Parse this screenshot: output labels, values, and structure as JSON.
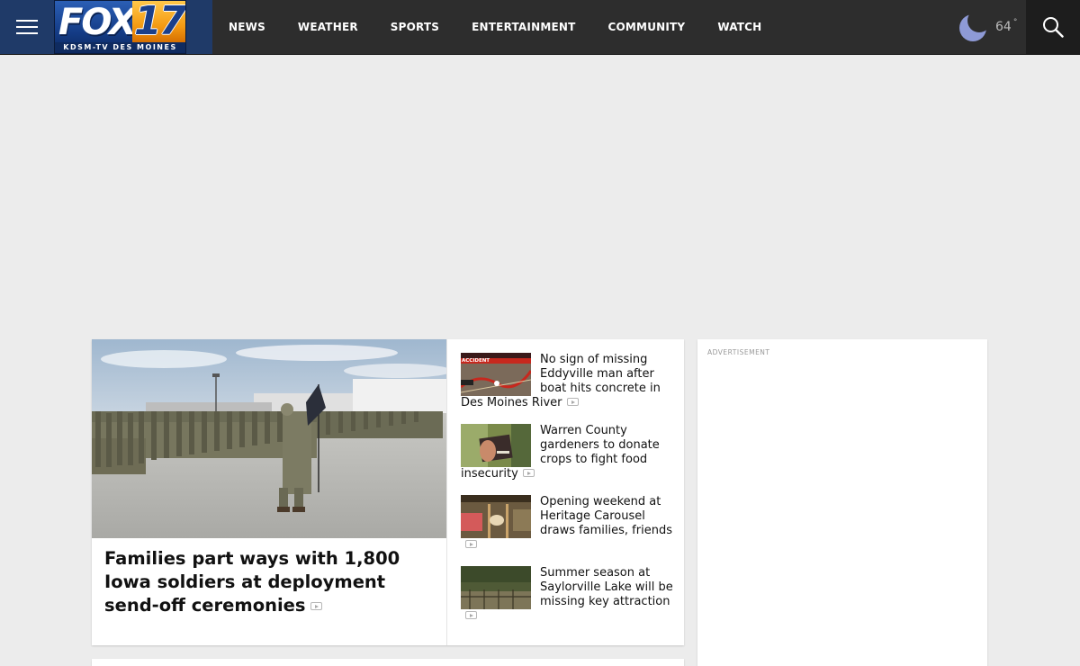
{
  "header": {
    "menu_icon": "hamburger-menu-icon",
    "logo": {
      "text_main": "FOX",
      "text_number": "17",
      "tagline": "KDSM-TV DES MOINES",
      "colors": {
        "blue": "#1f3a68",
        "orange": "#f49a12"
      }
    },
    "nav": [
      {
        "label": "NEWS"
      },
      {
        "label": "WEATHER"
      },
      {
        "label": "SPORTS"
      },
      {
        "label": "ENTERTAINMENT"
      },
      {
        "label": "COMMUNITY"
      },
      {
        "label": "WATCH"
      }
    ],
    "weather": {
      "icon": "crescent-moon-icon",
      "temperature": "64",
      "degree_symbol": "°"
    },
    "search_icon": "search-icon",
    "colors": {
      "bar": "#2d2d2d",
      "search_bg": "#1d1d1d"
    }
  },
  "lead_story": {
    "title": "Families part ways with 1,800 Iowa soldiers at deployment send-off ceremonies",
    "has_video": true,
    "image": "soldiers-formation-photo"
  },
  "side_stories": [
    {
      "title": "No sign of missing Eddyville man after boat hits concrete in Des Moines River",
      "has_video": true,
      "thumb": "accident-map-thumbnail",
      "thumb_badge": "ACCIDENT"
    },
    {
      "title": "Warren County gardeners to donate crops to fight food insecurity",
      "has_video": true,
      "thumb": "garden-sign-thumbnail"
    },
    {
      "title": "Opening weekend at Heritage Carousel draws families, friends",
      "has_video": true,
      "thumb": "carousel-thumbnail"
    },
    {
      "title": "Summer season at Saylorville Lake will be missing key attraction",
      "has_video": true,
      "thumb": "lake-thumbnail"
    }
  ],
  "ad": {
    "label": "ADVERTISEMENT"
  },
  "colors": {
    "page_bg": "#ececec",
    "card_bg": "#ffffff"
  }
}
